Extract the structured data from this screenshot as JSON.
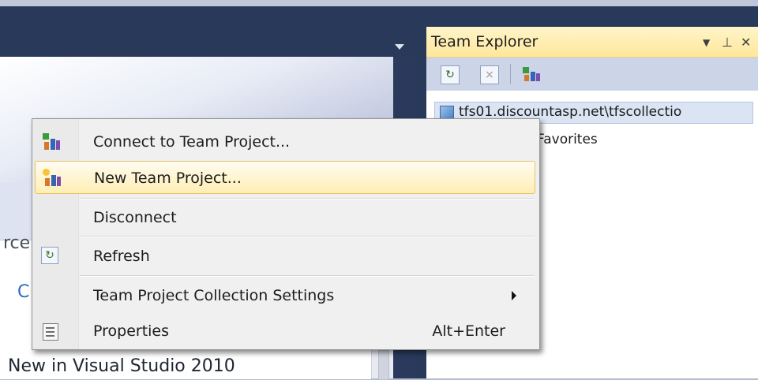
{
  "team_explorer": {
    "title": "Team Explorer",
    "dropdown_symbol": "▼",
    "pin_symbol": "⊥",
    "close_symbol": "✕",
    "server_node": "tfs01.discountasp.net\\tfscollectio",
    "favorites": "Favorites",
    "toolbar": {
      "refresh_icon": "↻",
      "stop_icon": "×"
    }
  },
  "background": {
    "partial_rc": "rce",
    "partial_c": "C",
    "whats_new": "New in Visual Studio 2010"
  },
  "context_menu": {
    "items": [
      {
        "label": "Connect to Team Project...",
        "icon": "team-project-icon"
      },
      {
        "label": "New Team Project...",
        "icon": "new-team-project-icon",
        "selected": true
      },
      {
        "label": "Disconnect"
      },
      {
        "label": "Refresh",
        "icon": "refresh-icon"
      },
      {
        "label": "Team Project Collection Settings",
        "submenu": true
      },
      {
        "label": "Properties",
        "icon": "properties-icon",
        "shortcut": "Alt+Enter"
      }
    ]
  },
  "colors": {
    "accent_selection": "#ffeeb4",
    "title_bar": "#ffe79c",
    "chrome_dark": "#29395a"
  }
}
